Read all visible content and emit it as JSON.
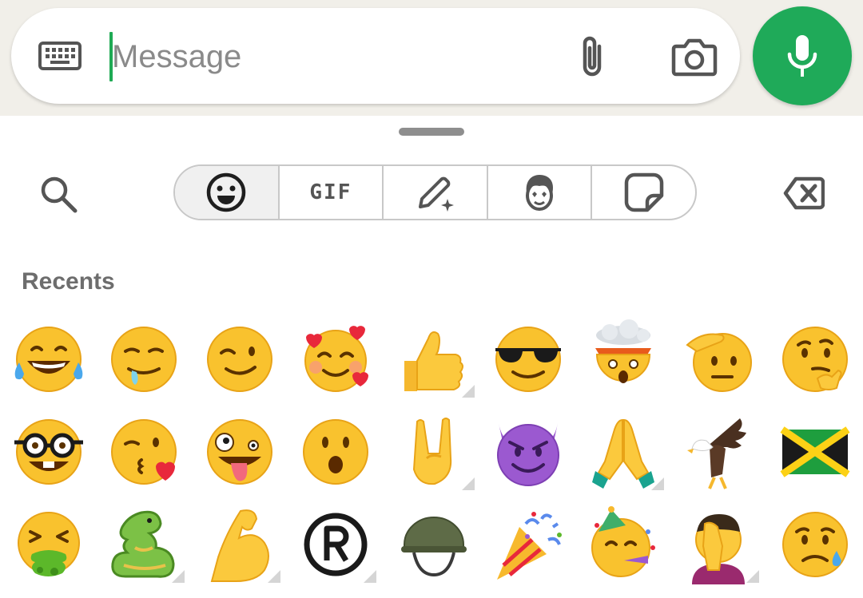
{
  "composer": {
    "placeholder": "Message",
    "keyboard_icon": "keyboard-icon",
    "attach_icon": "paperclip-icon",
    "camera_icon": "camera-icon",
    "mic_icon": "microphone-icon",
    "accent_color": "#1faa59"
  },
  "panel": {
    "tabs": [
      {
        "name": "emoji",
        "icon": "smiley-icon",
        "selected": true
      },
      {
        "name": "gif",
        "label": "GIF",
        "selected": false
      },
      {
        "name": "create",
        "icon": "pencil-sparkle-icon",
        "selected": false
      },
      {
        "name": "avatar",
        "icon": "avatar-icon",
        "selected": false
      },
      {
        "name": "stickers",
        "icon": "sticker-icon",
        "selected": false
      }
    ],
    "section_title": "Recents",
    "emojis": [
      [
        "tears-of-joy",
        "drooling-face",
        "winking-face",
        "smiling-face-with-hearts",
        "thumbs-up",
        "smiling-face-with-sunglasses",
        "exploding-head",
        "saluting-face",
        "thinking-face"
      ],
      [
        "nerd-face",
        "face-blowing-kiss",
        "zany-face",
        "face-with-open-mouth",
        "sign-of-the-horns",
        "smiling-face-with-horns",
        "folded-hands",
        "eagle",
        "flag-jamaica"
      ],
      [
        "face-vomiting",
        "dragon",
        "flexed-biceps",
        "registered-sign",
        "military-helmet",
        "party-popper",
        "partying-face",
        "person-facepalming",
        "sad-but-relieved-face"
      ]
    ],
    "skin_tone_variants": [
      "thumbs-up",
      "sign-of-the-horns",
      "folded-hands",
      "dragon",
      "flexed-biceps",
      "registered-sign",
      "person-facepalming"
    ]
  }
}
